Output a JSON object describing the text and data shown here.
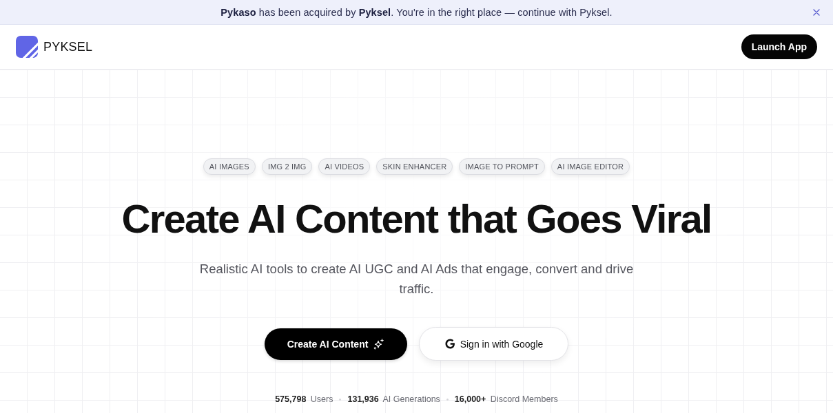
{
  "banner": {
    "message": "**Pykaso** has been acquired by **Pyksel**. You're in the right place — continue with Pyksel."
  },
  "header": {
    "logo_text": "PYKSEL",
    "launch_button": "Launch App"
  },
  "hero": {
    "tags": [
      "AI IMAGES",
      "IMG 2 IMG",
      "AI VIDEOS",
      "SKIN ENHANCER",
      "IMAGE TO PROMPT",
      "AI IMAGE EDITOR"
    ],
    "title": "Create AI Content that Goes Viral",
    "subtitle": "Realistic AI tools to create AI UGC and AI Ads that engage, convert and drive traffic.",
    "primary_button": "Create AI Content",
    "google_button": "Sign in with Google",
    "stats": [
      "**575,798** Users",
      "**131,936** AI Generations",
      "**16,000+** Discord Members"
    ]
  }
}
